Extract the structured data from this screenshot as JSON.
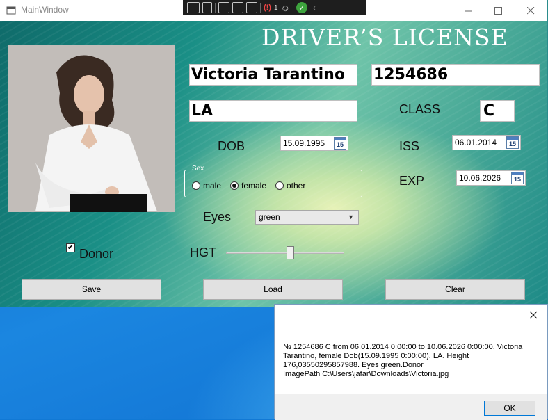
{
  "window": {
    "title": "MainWindow"
  },
  "debug_toolbar": {
    "error_count": "1",
    "icons": [
      "live-visual-tree-icon",
      "record-icon",
      "select-element-icon",
      "display-layout-adorners-icon",
      "track-focus-icon",
      "binding-failures-icon",
      "accessibility-checker-icon",
      "hot-reload-ok-icon",
      "collapse-arrow-icon"
    ]
  },
  "form": {
    "heading": "DRIVER’S LICENSE",
    "name": "Victoria Tarantino",
    "number": "1254686",
    "state": "LA",
    "class_label": "CLASS",
    "class_value": "C",
    "dob_label": "DOB",
    "dob_value": "15.09.1995",
    "iss_label": "ISS",
    "iss_value": "06.01.2014",
    "exp_label": "EXP",
    "exp_value": "10.06.2026",
    "calendar_day": "15",
    "sex": {
      "legend": "Sex",
      "options": [
        {
          "label": "male",
          "checked": false
        },
        {
          "label": "female",
          "checked": true
        },
        {
          "label": "other",
          "checked": false
        }
      ]
    },
    "eyes_label": "Eyes",
    "eyes_value": "green",
    "donor_label": "Donor",
    "donor_checked": true,
    "donor_check_mark": "✔",
    "height_label": "HGT",
    "height_value": 176.03550295857988,
    "buttons": {
      "save": "Save",
      "load": "Load",
      "clear": "Clear"
    }
  },
  "message_box": {
    "text": "№ 1254686 C from 06.01.2014 0:00:00 to 10.06.2026 0:00:00. Victoria Tarantino, female Dob(15.09.1995 0:00:00). LA. Height 176,03550295857988. Eyes green.Donor\n ImagePath C:\\Users\\jafar\\Downloads\\Victoria.jpg",
    "ok_label": "OK"
  },
  "colors": {
    "accent": "#0078d7",
    "form_gradient_dark": "#0f6b6a",
    "form_gradient_light": "#e7f2b8",
    "desktop_blue": "#1279d4"
  }
}
